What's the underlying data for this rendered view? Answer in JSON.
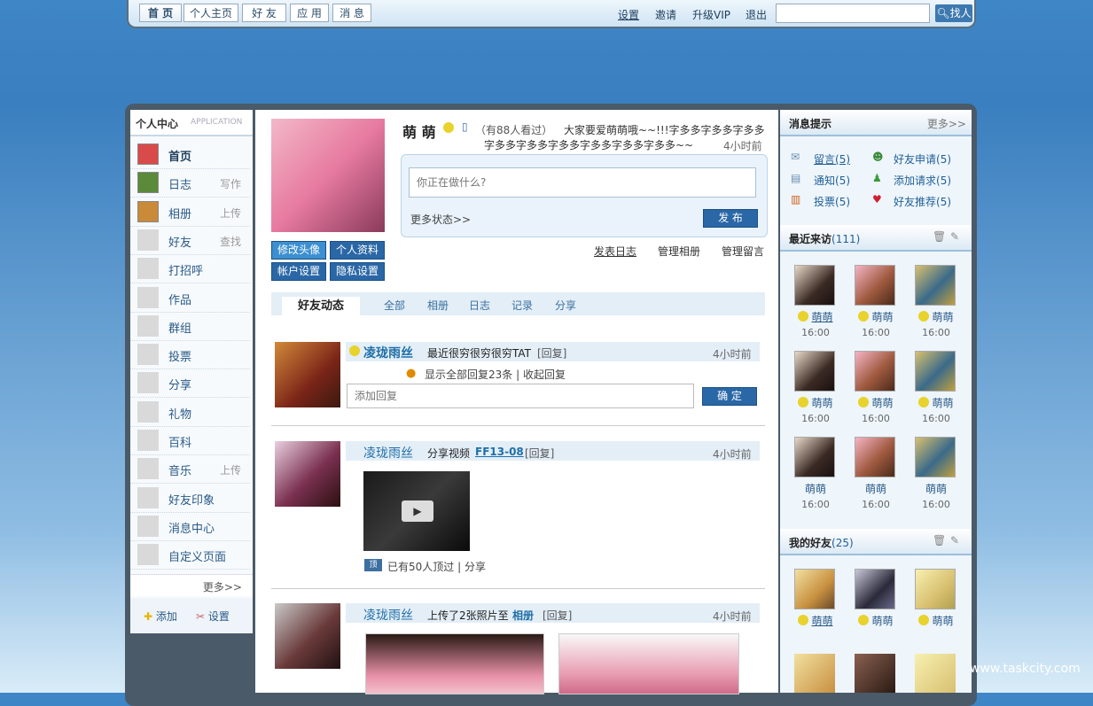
{
  "top_nav": {
    "tabs": [
      "首 页",
      "个人主页",
      "好 友",
      "应 用",
      "消 息"
    ],
    "links": [
      "设置",
      "邀请",
      "升级VIP",
      "退出"
    ],
    "search_placeholder": "",
    "find_label": "找人"
  },
  "left_menu": {
    "title": "个人中心",
    "title_en": "APPLICATION",
    "items": [
      {
        "label": "首页",
        "sub": ""
      },
      {
        "label": "日志",
        "sub": "写作"
      },
      {
        "label": "相册",
        "sub": "上传"
      },
      {
        "label": "好友",
        "sub": "查找"
      },
      {
        "label": "打招呼",
        "sub": ""
      },
      {
        "label": "作品",
        "sub": ""
      },
      {
        "label": "群组",
        "sub": ""
      },
      {
        "label": "投票",
        "sub": ""
      },
      {
        "label": "分享",
        "sub": ""
      },
      {
        "label": "礼物",
        "sub": ""
      },
      {
        "label": "百科",
        "sub": ""
      },
      {
        "label": "音乐",
        "sub": "上传"
      },
      {
        "label": "好友印象",
        "sub": ""
      },
      {
        "label": "消息中心",
        "sub": ""
      },
      {
        "label": "自定义页面",
        "sub": ""
      }
    ],
    "more": "更多>>",
    "add": "添加",
    "settings": "设置"
  },
  "profile": {
    "name": "萌 萌",
    "viewed": "（有88人看过）",
    "status_line1": "大家要爱萌萌哦~~!!!字多多字多多字多多",
    "status_line2": "字多多字多多字多多字多多字多多字多多~~",
    "status_time": "4小时前",
    "status_placeholder": "你正在做什么?",
    "more_status": "更多状态>>",
    "publish": "发 布",
    "buttons": [
      "修改头像",
      "个人资料",
      "帐户设置",
      "隐私设置"
    ],
    "actions": [
      "发表日志",
      "管理相册",
      "管理留言"
    ]
  },
  "feed_tabs": {
    "active": "好友动态",
    "tabs": [
      "全部",
      "相册",
      "日志",
      "记录",
      "分享"
    ]
  },
  "feed": [
    {
      "user": "凌珑雨丝",
      "text": "最近很穷很穷很穷TAT",
      "reply": "[回复]",
      "time": "4小时前",
      "replies_info": "显示全部回复23条 | 收起回复",
      "reply_placeholder": "添加回复",
      "confirm": "确 定"
    },
    {
      "user": "凌珑雨丝",
      "text": "分享视频",
      "link": "FF13-08",
      "reply": "[回复]",
      "time": "4小时前",
      "views": "已有50人顶过 | 分享"
    },
    {
      "user": "凌珑雨丝",
      "text": "上传了2张照片至",
      "link": "相册",
      "reply": "[回复]",
      "time": "4小时前"
    }
  ],
  "messages": {
    "title": "消息提示",
    "more": "更多>>",
    "items": [
      {
        "label": "留言",
        "count": "(5)"
      },
      {
        "label": "好友申请",
        "count": "(5)"
      },
      {
        "label": "通知",
        "count": "(5)"
      },
      {
        "label": "添加请求",
        "count": "(5)"
      },
      {
        "label": "投票",
        "count": "(5)"
      },
      {
        "label": "好友推荐",
        "count": "(5)"
      }
    ]
  },
  "recent_visitors": {
    "title": "最近来访",
    "count": "(111)",
    "visitors": [
      {
        "name": "萌萌",
        "time": "16:00"
      },
      {
        "name": "萌萌",
        "time": "16:00"
      },
      {
        "name": "萌萌",
        "time": "16:00"
      },
      {
        "name": "萌萌",
        "time": "16:00"
      },
      {
        "name": "萌萌",
        "time": "16:00"
      },
      {
        "name": "萌萌",
        "time": "16:00"
      },
      {
        "name": "萌萌",
        "time": "16:00"
      },
      {
        "name": "萌萌",
        "time": "16:00"
      },
      {
        "name": "萌萌",
        "time": "16:00"
      }
    ]
  },
  "my_friends": {
    "title": "我的好友",
    "count": "(25)",
    "friends": [
      {
        "name": "萌萌"
      },
      {
        "name": "萌萌"
      },
      {
        "name": "萌萌"
      }
    ]
  },
  "watermark": "www.taskcity.com"
}
